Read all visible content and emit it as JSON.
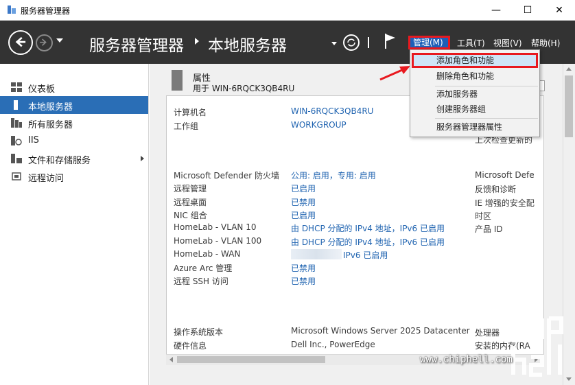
{
  "window": {
    "title": "服务器管理器",
    "controls": {
      "minimize": "—",
      "maximize": "☐",
      "close": "✕"
    }
  },
  "header": {
    "breadcrumb": [
      "服务器管理器",
      "本地服务器"
    ],
    "menus": {
      "manage": "管理(M)",
      "tools": "工具(T)",
      "view": "视图(V)",
      "help": "帮助(H)"
    },
    "icons": [
      "back-icon",
      "forward-icon",
      "refresh-icon",
      "flag-icon"
    ]
  },
  "manage_menu": {
    "items": [
      "添加角色和功能",
      "删除角色和功能",
      "添加服务器",
      "创建服务器组",
      "服务器管理器属性"
    ],
    "highlighted": "添加角色和功能"
  },
  "sidebar": {
    "items": [
      {
        "label": "仪表板",
        "icon": "dashboard-icon"
      },
      {
        "label": "本地服务器",
        "icon": "local-server-icon",
        "active": true
      },
      {
        "label": "所有服务器",
        "icon": "all-servers-icon"
      },
      {
        "label": "IIS",
        "icon": "iis-icon"
      },
      {
        "label": "文件和存储服务",
        "icon": "storage-icon",
        "expandable": true
      },
      {
        "label": "远程访问",
        "icon": "remote-access-icon"
      }
    ]
  },
  "properties": {
    "title": "属性",
    "subtitle": "用于 WIN-6RQCK3QB4RU",
    "group1": [
      {
        "key": "计算机名",
        "value": "WIN-6RQCK3QB4RU"
      },
      {
        "key": "工作组",
        "value": "WORKGROUP"
      }
    ],
    "group2": [
      {
        "key": "Microsoft Defender 防火墙",
        "value": "公用: 启用，专用: 启用"
      },
      {
        "key": "远程管理",
        "value": "已启用"
      },
      {
        "key": "远程桌面",
        "value": "已禁用"
      },
      {
        "key": "NIC 组合",
        "value": "已启用"
      },
      {
        "key": "HomeLab - VLAN 10",
        "value": "由 DHCP 分配的 IPv4 地址，IPv6 已启用"
      },
      {
        "key": "HomeLab - VLAN 100",
        "value": "由 DHCP 分配的 IPv4 地址，IPv6 已启用"
      },
      {
        "key": "HomeLab - WAN",
        "value": "IPv6 已启用"
      },
      {
        "key": "Azure Arc 管理",
        "value": "已禁用"
      },
      {
        "key": "远程 SSH 访问",
        "value": "已禁用"
      }
    ],
    "group3": [
      {
        "key": "操作系统版本",
        "value": "Microsoft Windows Server 2025 Datacenter"
      },
      {
        "key": "硬件信息",
        "value": "Dell Inc.,   PowerEdge"
      }
    ],
    "right_col": [
      "上次检查更新的",
      "Microsoft Defe",
      "反馈和诊断",
      "IE 增强的安全配",
      "时区",
      "产品 ID",
      "处理器",
      "安装的内存(RA"
    ]
  },
  "watermark": {
    "url": "www.chiphell.com",
    "logo": "chip hell"
  },
  "colors": {
    "accent": "#2a6eb6",
    "link": "#1f63b0",
    "header": "#333333",
    "highlight_border": "#e8191f"
  }
}
